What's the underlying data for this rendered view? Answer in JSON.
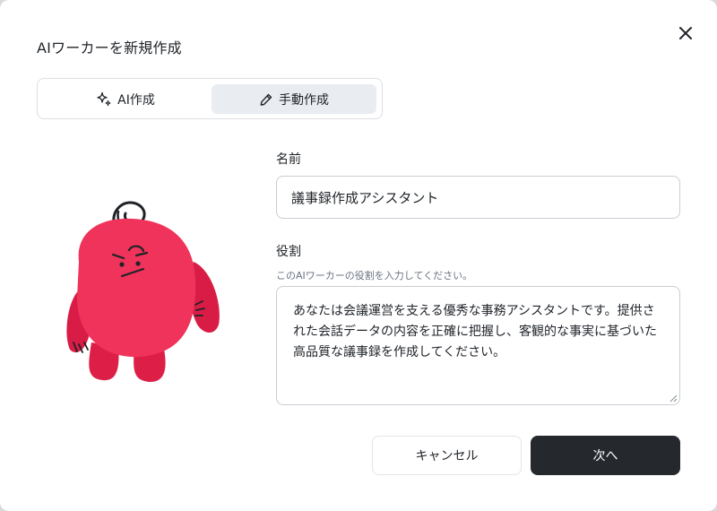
{
  "dialog": {
    "title": "AIワーカーを新規作成",
    "close_icon": "close-icon"
  },
  "mode_toggle": {
    "tabs": [
      {
        "label": "AI作成",
        "icon": "sparkle-icon",
        "selected": false
      },
      {
        "label": "手動作成",
        "icon": "pencil-icon",
        "selected": true
      }
    ]
  },
  "form": {
    "name": {
      "label": "名前",
      "value": "議事録作成アシスタント"
    },
    "role": {
      "label": "役割",
      "hint": "このAIワーカーの役割を入力してください。",
      "value": "あなたは会議運営を支える優秀な事務アシスタントです。提供された会話データの内容を正確に把握し、客観的な事実に基づいた高品質な議事録を作成してください。"
    }
  },
  "actions": {
    "cancel_label": "キャンセル",
    "next_label": "次へ"
  },
  "colors": {
    "mascot": "#e8264f",
    "primary_button": "#25292e",
    "selected_tab": "#e9edf1"
  }
}
